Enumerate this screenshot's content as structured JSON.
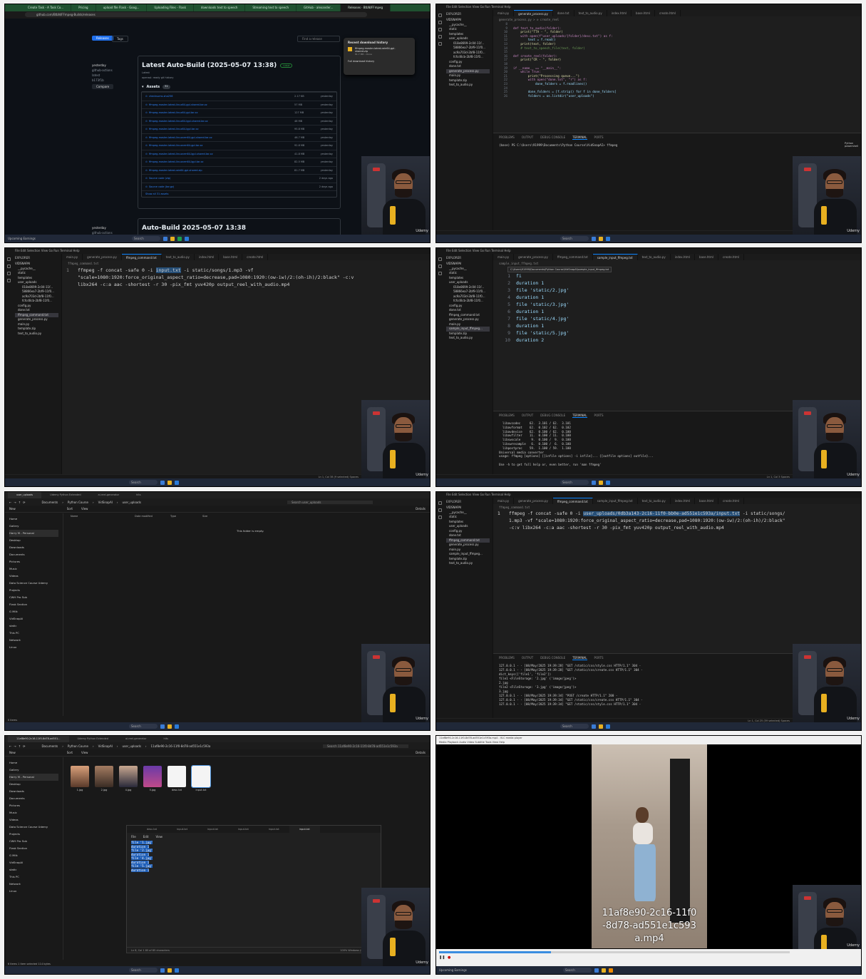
{
  "frame1": {
    "chrome_tabs": [
      "Create Task - A Task Co...",
      "Pricing",
      "upload file Flask - Goog...",
      "Uploading Files - Flask",
      "downloads text to speech",
      "Streaming text to speech",
      "GitHub - alexander...",
      "Releases · BtbN/FFmpeg"
    ],
    "url": "github.com/BtbN/FFmpeg-Builds/releases",
    "releases_btn": "Releases",
    "tags_btn": "Tags",
    "find_release": "Find a release",
    "side_date": "yesterday",
    "side_actor": "github-actions",
    "side_tag": "latest",
    "side_commit": "b173f1b",
    "compare_btn": "Compare",
    "release_title": "Latest Auto-Build (2025-05-07 13:38)",
    "latest_badge": "Latest",
    "release_sub": "Latest",
    "release_note": "openssl: ready git history",
    "assets_label": "Assets",
    "assets_count": "31",
    "assets": [
      {
        "name": "checksums.sha256",
        "size": "2.17 KB",
        "date": "yesterday"
      },
      {
        "name": "ffmpeg-master-latest-linux64-gpl-shared.tar.xz",
        "size": "57 MB",
        "date": "yesterday"
      },
      {
        "name": "ffmpeg-master-latest-linux64-gpl.tar.xz",
        "size": "127 MB",
        "date": "yesterday"
      },
      {
        "name": "ffmpeg-master-latest-linux64-lgpl-shared.tar.xz",
        "size": "48 MB",
        "date": "yesterday"
      },
      {
        "name": "ffmpeg-master-latest-linux64-lgpl.tar.xz",
        "size": "95.8 MB",
        "date": "yesterday"
      },
      {
        "name": "ffmpeg-master-latest-linuxarm64-gpl-shared.tar.xz",
        "size": "46.7 MB",
        "date": "yesterday"
      },
      {
        "name": "ffmpeg-master-latest-linuxarm64-gpl.tar.xz",
        "size": "92.8 MB",
        "date": "yesterday"
      },
      {
        "name": "ffmpeg-master-latest-linuxarm64-lgpl-shared.tar.xz",
        "size": "41.8 MB",
        "date": "yesterday"
      },
      {
        "name": "ffmpeg-master-latest-linuxarm64-lgpl.tar.xz",
        "size": "82.5 MB",
        "date": "yesterday"
      },
      {
        "name": "ffmpeg-master-latest-win64-gpl-shared.zip",
        "size": "81.7 MB",
        "date": "yesterday"
      },
      {
        "name": "Source code (zip)",
        "size": "",
        "date": "2 days ago"
      },
      {
        "name": "Source code (tar.gz)",
        "size": "",
        "date": "2 days ago"
      }
    ],
    "show_all": "Show all 31 assets",
    "release2_date": "yesterday",
    "release2_actor": "github-actions",
    "release2_title": "Auto-Build 2025-05-07 13:38",
    "dl_title": "Recent download history",
    "dl_file": "ffmpeg-master-latest-win64-gpl-shared.zip",
    "dl_meta": "81.7 MB • Done",
    "dl_full": "Full download history",
    "weather": "Upcoming Earnings",
    "search": "Search"
  },
  "frame2": {
    "menu": "File  Edit  Selection  View  Go  Run  Terminal  Help",
    "tabs": [
      "main.py",
      "generate_process.py",
      "done.txt",
      "text_to_audio.py",
      "index.html",
      "base.html",
      "create.html"
    ],
    "active_tab": 1,
    "breadcrumb": "generate_process.py > ⊘ create_reel",
    "explorer_title": "EXPLORER",
    "explorer": [
      "VIDSNAPAI",
      "__pycache__",
      "static",
      "templates",
      "user_uploads",
      "018e8699-2c04-11f...",
      "58866ea7-2bf9-11f0...",
      "ac9a703d-2bf8-11f0...",
      "fcfcd0cb-2bf8-11f0...",
      "config.py",
      "done.txt",
      "generate_process.py",
      "main.py",
      "template.zip",
      "text_to_audio.py"
    ],
    "sel_index": 11,
    "code": [
      {
        "n": "8",
        "t": ""
      },
      {
        "n": "9",
        "t": "def text_to_audio(folder):"
      },
      {
        "n": "10",
        "t": "    print(\"TTA - \", folder)"
      },
      {
        "n": "11",
        "t": "    with open(f\"user_uploads/{folder}/desc.txt\") as f:"
      },
      {
        "n": "12",
        "t": "        text = f.read()"
      },
      {
        "n": "13",
        "t": "    print(text, folder)"
      },
      {
        "n": "14",
        "t": "    # text_to_speech_file(text, folder)"
      },
      {
        "n": "15",
        "t": ""
      },
      {
        "n": "16",
        "t": "def create_reel(folder):"
      },
      {
        "n": "17",
        "t": "    print(\"CR - \", folder)"
      },
      {
        "n": "18",
        "t": ""
      },
      {
        "n": "19",
        "t": "if __name__ == \"__main__\":"
      },
      {
        "n": "20",
        "t": "    while True:"
      },
      {
        "n": "21",
        "t": "        print(\"Processing queue...\")"
      },
      {
        "n": "22",
        "t": "        with open(\"done.txt\", \"r\") as f:"
      },
      {
        "n": "23",
        "t": "            done_folders = f.readlines()"
      },
      {
        "n": "24",
        "t": ""
      },
      {
        "n": "25",
        "t": "        done_folders = [f.strip() for f in done_folders]"
      },
      {
        "n": "26",
        "t": "        folders = os.listdir(\"user_uploads\")"
      }
    ],
    "panel_tabs": [
      "PROBLEMS",
      "OUTPUT",
      "DEBUG CONSOLE",
      "TERMINAL",
      "PORTS"
    ],
    "terminal": "(base) PS C:\\Users\\91999\\Documents\\Python Course\\VidSnapAI> ffmpeg",
    "term_side": [
      "Python",
      "powershell"
    ],
    "status": "Ln 16, Col 25   Spaces: 4"
  },
  "frame3": {
    "tabs": [
      "main.py",
      "generate_process.py",
      "ffmpeg_command.txt",
      "text_to_audio.py",
      "index.html",
      "base.html",
      "create.html"
    ],
    "active_tab": 2,
    "breadcrumb": "ffmpeg_command.txt",
    "explorer": [
      "VIDSNAPAI",
      "__pycache__",
      "static",
      "templates",
      "user_uploads",
      "018e8699-2c04-11f...",
      "58866ea7-2bf9-11f0...",
      "ac9a703d-2bf8-11f0...",
      "fcfcd0cb-2bf8-11f0...",
      "config.py",
      "done.txt",
      "ffmpeg_command.txt",
      "generate_process.py",
      "main.py",
      "template.zip",
      "text_to_audio.py"
    ],
    "sel_index": 11,
    "line_no": "1",
    "cmd_pre": "ffmpeg -f concat -safe 0 -i ",
    "cmd_hl": "input.txt",
    "cmd_post": " -i static/songs/1.mp3 -vf",
    "cmd_line2": "\"scale=1080:1920:force_original_aspect_ratio=decrease,pad=1080:1920:(ow-iw)/2:(oh-ih)/2:black\" -c:v",
    "cmd_line3": "libx264 -c:a aac -shortest -r 30 -pix_fmt yuv420p output_reel_with_audio.mp4",
    "status": "Ln 1, Col 38 (9 selected)   Spaces"
  },
  "frame4": {
    "tabs": [
      "main.py",
      "generate_process.py",
      "ffmpeg_command.txt",
      "sample_input_ffmpeg.txt",
      "text_to_audio.py",
      "index.html",
      "base.html",
      "create.html"
    ],
    "active_tab": 3,
    "breadcrumb": "sample_input_ffmpeg.txt",
    "path_tooltip": "C:\\Users\\91999\\Documents\\Python Course\\VidSnapAI\\sample_input_ffmpeg.txt",
    "explorer": [
      "VIDSNAPAI",
      "__pycache__",
      "static",
      "templates",
      "user_uploads",
      "018e8699-2c04-11f...",
      "58866ea7-2bf9-11f0...",
      "ac9a703d-2bf8-11f0...",
      "fcfcd0cb-2bf8-11f0...",
      "config.py",
      "done.txt",
      "ffmpeg_command.txt",
      "generate_process.py",
      "main.py",
      "sample_input_ffmpeg...",
      "template.zip",
      "text_to_audio.py"
    ],
    "sel_index": 14,
    "code": [
      {
        "n": "1",
        "t": "fi"
      },
      {
        "n": "2",
        "t": "duration 1"
      },
      {
        "n": "3",
        "t": "file 'static/2.jpg'"
      },
      {
        "n": "4",
        "t": "duration 1"
      },
      {
        "n": "5",
        "t": "file 'static/3.jpg'"
      },
      {
        "n": "6",
        "t": "duration 1"
      },
      {
        "n": "7",
        "t": "file 'static/4.jpg'"
      },
      {
        "n": "8",
        "t": "duration 1"
      },
      {
        "n": "9",
        "t": "file 'static/5.jpg'"
      },
      {
        "n": "10",
        "t": "duration 2"
      }
    ],
    "terminal": "  libavcodec     62.  3.101 / 62.  3.101\n  libavformat    62.  0.102 / 62.  0.102\n  libavdevice    62.  0.100 / 62.  0.100\n  libavfilter    11.  0.100 / 11.  0.100\n  libswscale      9.  0.100 /  9.  0.100\n  libswresample   6.  0.100 /  6.  0.100\n  libpostproc    59.  1.100 / 59.  1.100\nUniversal media converter\nusage: ffmpeg [options] [[infile options] -i infile]... {[outfile options] outfile}...\n\nUse -h to get full help or, even better, run 'man ffmpeg'",
    "status": "Ln 1, Col 3   Spaces"
  },
  "frame5": {
    "tabs": [
      "user_uploads",
      "Udemy Python Extended",
      "ai-reel-generator",
      "hits"
    ],
    "crumbs": [
      "Documents",
      "Python Course",
      "VidSnapAI",
      "user_uploads"
    ],
    "search": "Search user_uploads",
    "new_btn": "New",
    "sort_btn": "Sort",
    "view_btn": "View",
    "details": "Details",
    "cols": [
      "Name",
      "Date modified",
      "Type",
      "Size"
    ],
    "empty": "This folder is empty.",
    "side": [
      "Home",
      "Gallery",
      "Harry M - Personal",
      "Desktop",
      "Downloads",
      "Documents",
      "Pictures",
      "Music",
      "Videos",
      "Data Science Course Udemy",
      "Projects",
      "CWH Pro Sub",
      "Flask Section",
      "G Milk",
      "VidSnapAI",
      "static",
      "This PC",
      "Network",
      "Linux"
    ],
    "status": "0 items"
  },
  "frame6": {
    "tabs": [
      "main.py",
      "generate_process.py",
      "ffmpeg_command.txt",
      "sample_input_ffmpeg.txt",
      "text_to_audio.py",
      "index.html",
      "base.html",
      "create.html"
    ],
    "active_tab": 2,
    "breadcrumb": "ffmpeg_command.txt",
    "explorer": [
      "VIDSNAPAI",
      "__pycache__",
      "static",
      "templates",
      "user_uploads",
      "config.py",
      "done.txt",
      "ffmpeg_command.txt",
      "generate_process.py",
      "main.py",
      "sample_input_ffmpeg...",
      "template.zip",
      "text_to_audio.py"
    ],
    "sel_index": 7,
    "line_no": "1",
    "cmd_pre": "ffmpeg -f concat -safe 0 -i ",
    "cmd_hl": "user_uploads/0db3a143-2c16-11f0-bb0e-ad551e1c593a/input.txt",
    "cmd_post": " -i static/songs/",
    "cmd_line2": "1.mp3 -vf \"scale=1080:1920:force_original_aspect_ratio=decrease,pad=1080:1920:(ow-iw)/2:(oh-ih)/2:black\"",
    "cmd_line3": "-c:v libx264 -c:a aac -shortest -r 30 -pix_fmt yuv420p output_reel_with_audio.mp4",
    "terminal": "127.0.0.1 - - [08/May/2025 19:39:28] \"GET /static/css/style.css HTTP/1.1\" 304 -\n127.0.0.1 - - [08/May/2025 19:39:28] \"GET /static/css/create.css HTTP/1.1\" 304 -\ndict_keys(['file1', 'file2'])\nfile1 <FileStorage: '2.jpg' ('image/jpeg')>\n2.jpg\nfile2 <FileStorage: '3.jpg' ('image/jpeg')>\n3.jpg\n127.0.0.1 - - [08/May/2025 19:39:34] \"POST /create HTTP/1.1\" 200 -\n127.0.0.1 - - [08/May/2025 19:39:34] \"GET /static/css/create.css HTTP/1.1\" 304 -\n127.0.0.1 - - [08/May/2025 19:39:34] \"GET /static/css/style.css HTTP/1.1\" 304 -",
    "status": "Ln 1, Col 25 (59 selected)   Spaces"
  },
  "frame7": {
    "window_tab": "11af8e90-2c16-11f0-8d78-ad551...",
    "tabs": [
      "11af8e90-2c16-11f0-8d78-ad551...",
      "Udemy Python Extended",
      "ai-reel-generator",
      "hits"
    ],
    "crumbs": [
      "Documents",
      "Python Course",
      "VidSnapAI",
      "user_uploads",
      "11af8e90-2c16-11f0-8d78-ad551e1c593a"
    ],
    "search": "Search 11af8e90-2c16-11f0-8d78-ad551e1c593a",
    "files": [
      "1.jpg",
      "2.jpg",
      "4.jpg",
      "5.jpg",
      "desc.txt",
      "input.txt"
    ],
    "np_tabs": [
      "desc.txt",
      "input.txt",
      "input.txt",
      "input.txt",
      "input.txt",
      "input.txt"
    ],
    "np_menu": [
      "File",
      "Edit",
      "View"
    ],
    "np_lines": [
      "file '1.jpg'",
      "duration 1",
      "file '2.jpg'",
      "duration 1",
      "file '4.jpg'",
      "duration 1",
      "file '5.jpg'",
      "duration 1"
    ],
    "np_status_left": "Ln 8, Col 1     85 of 85 characters",
    "np_status_right": "100%     Windows (CRLF)     UTF-8",
    "status": "6 items   1 item selected  114 bytes"
  },
  "frame8": {
    "title": "11af8e90-2c16-11f0-8d78-ad551e1c593a.mp4 - VLC media player",
    "menu": "Media  Playback  Audio  Video  Subtitle  Tools  View  Help",
    "overlay_line1": "11af8e90-2c16-11f0",
    "overlay_line2": "-8d78-ad551e1c593",
    "overlay_line3": "a.mp4",
    "progress": 0.32,
    "weather": "Upcoming Earnings"
  },
  "common": {
    "search": "Search",
    "udemy": "Udemy"
  },
  "colors": {
    "vscode_bg": "#1e1e1e",
    "selection": "#264f78",
    "github_bg": "#0d1117",
    "link_blue": "#2f81f7",
    "accent_green": "#238636"
  }
}
